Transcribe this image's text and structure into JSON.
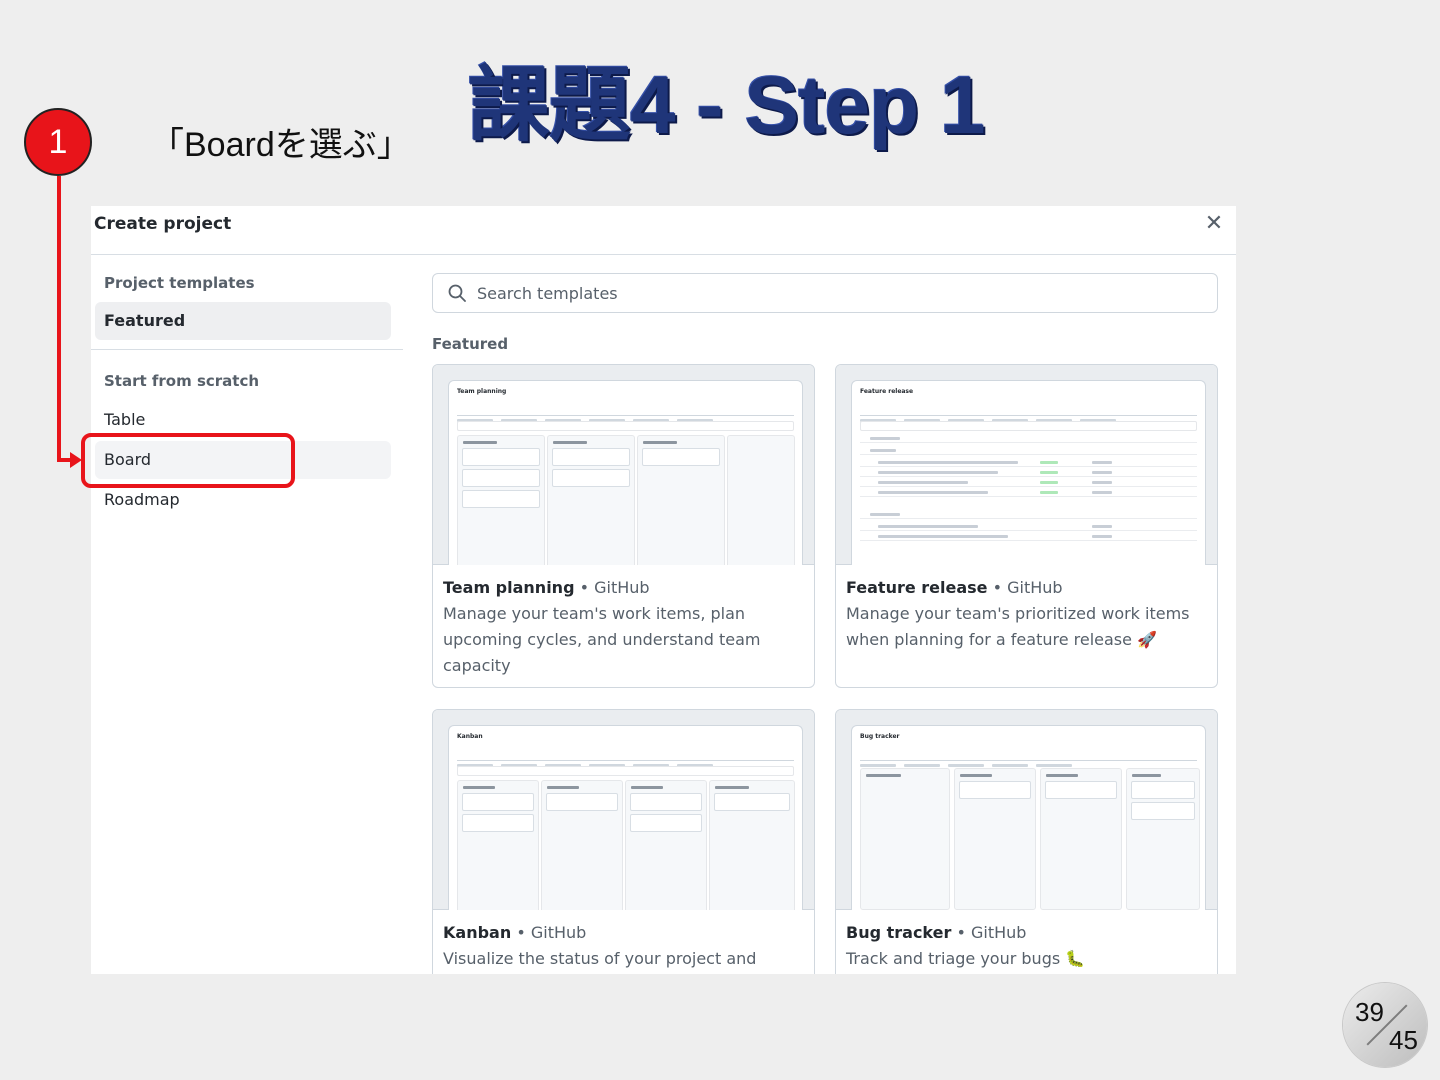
{
  "slide": {
    "title": "課題4 - Step 1",
    "step_number": "1",
    "step_caption": "「Boardを選ぶ」",
    "page_current": "39",
    "page_total": "45"
  },
  "dialog": {
    "title": "Create project",
    "close_icon": "close-icon"
  },
  "sidebar": {
    "templates_heading": "Project templates",
    "featured_label": "Featured",
    "scratch_heading": "Start from scratch",
    "items": [
      {
        "label": "Table"
      },
      {
        "label": "Board"
      },
      {
        "label": "Roadmap"
      }
    ]
  },
  "search": {
    "placeholder": "Search templates",
    "icon": "search-icon"
  },
  "main": {
    "section_label": "Featured",
    "cards": [
      {
        "name": "Team planning",
        "separator": " • ",
        "owner": "GitHub",
        "description": "Manage your team's work items, plan upcoming cycles, and understand team capacity",
        "preview_title": "Team planning"
      },
      {
        "name": "Feature release",
        "separator": " • ",
        "owner": "GitHub",
        "description": "Manage your team's prioritized work items when planning for a feature release 🚀",
        "preview_title": "Feature release"
      },
      {
        "name": "Kanban",
        "separator": " • ",
        "owner": "GitHub",
        "description": "Visualize the status of your project and limit",
        "preview_title": "Kanban"
      },
      {
        "name": "Bug tracker",
        "separator": " • ",
        "owner": "GitHub",
        "description": "Track and triage your bugs 🐛",
        "preview_title": "Bug tracker"
      }
    ]
  },
  "colors": {
    "title_blue": "#1f3579",
    "accent_red": "#e8141a",
    "slide_bg": "#eeeeee"
  }
}
